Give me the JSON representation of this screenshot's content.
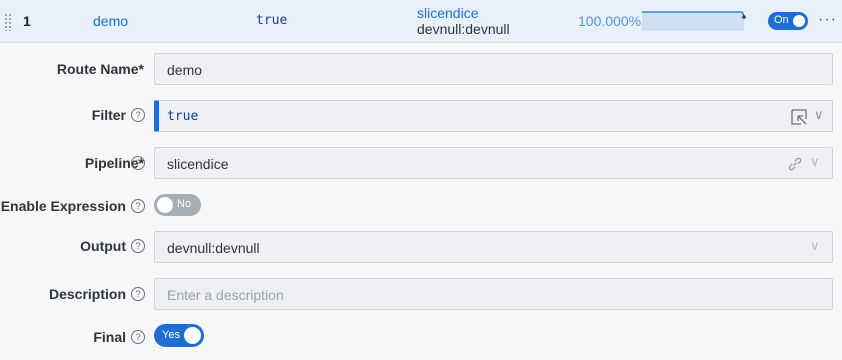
{
  "summary": {
    "route_number": "1",
    "name": "demo",
    "filter": "true",
    "pipeline": "slicendice",
    "output": "devnull:devnull",
    "percent": "100.000%",
    "enabled_label": "On",
    "more": "···"
  },
  "form": {
    "route_name": {
      "label": "Route Name*",
      "value": "demo"
    },
    "filter": {
      "label": "Filter",
      "value": "true"
    },
    "pipeline": {
      "label": "Pipeline*",
      "value": "slicendice"
    },
    "enable_expression": {
      "label": "Enable Expression",
      "toggle_label": "No"
    },
    "output": {
      "label": "Output",
      "value": "devnull:devnull"
    },
    "description": {
      "label": "Description",
      "placeholder": "Enter a description"
    },
    "final": {
      "label": "Final",
      "toggle_label": "Yes"
    }
  },
  "help_glyph": "?",
  "chevron_glyph": "∨",
  "colors": {
    "accent": "#1f6ed4",
    "summary_bg": "#e8f0fa",
    "toggle_off": "#a7adb4"
  },
  "icons": [
    "drag-handle-icon",
    "help-icon",
    "expand-editor-icon",
    "link-icon",
    "chevron-down-icon",
    "more-icon"
  ]
}
